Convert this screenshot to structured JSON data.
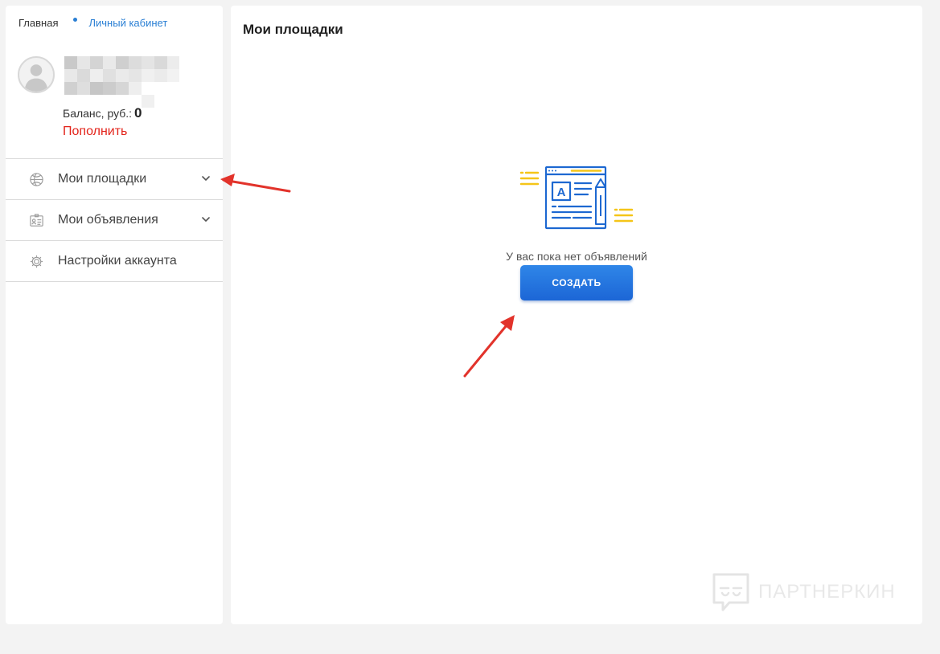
{
  "breadcrumb": {
    "home": "Главная",
    "current": "Личный кабинет"
  },
  "profile": {
    "balance_label": "Баланс, руб.:",
    "balance_value": "0",
    "topup_label": "Пополнить"
  },
  "menu": [
    {
      "label": "Мои площадки",
      "icon": "basketball-icon",
      "has_chevron": true
    },
    {
      "label": "Мои объявления",
      "icon": "id-card-icon",
      "has_chevron": true
    },
    {
      "label": "Настройки аккаунта",
      "icon": "settings-icon",
      "has_chevron": false
    }
  ],
  "main": {
    "title": "Мои площадки",
    "empty_text": "У вас пока нет объявлений",
    "create_button": "СОЗДАТЬ"
  },
  "watermark": {
    "text": "ПАРТНЕРКИН"
  },
  "colors": {
    "accent_blue": "#2a7fd4",
    "button_blue": "#1f6fdc",
    "topup_red": "#e3241b",
    "illustration_yellow": "#f5c518",
    "annotation_arrow": "#e2332b"
  }
}
